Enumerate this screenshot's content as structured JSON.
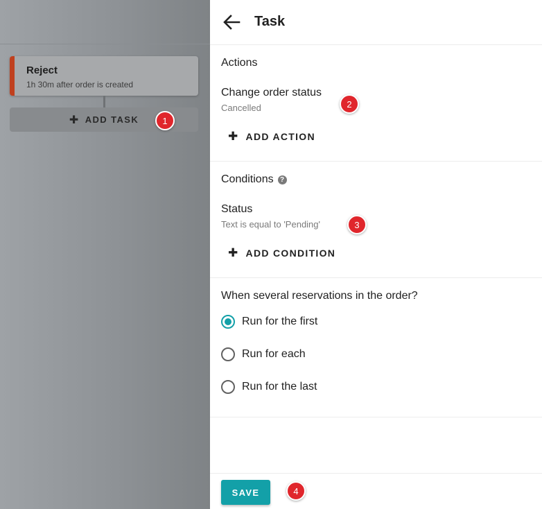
{
  "left": {
    "task_card": {
      "title": "Reject",
      "subtitle": "1h 30m after order is created"
    },
    "add_task_label": "ADD TASK"
  },
  "drawer": {
    "title": "Task",
    "actions": {
      "heading": "Actions",
      "item_title": "Change order status",
      "item_value": "Cancelled",
      "add_label": "ADD ACTION"
    },
    "conditions": {
      "heading": "Conditions",
      "item_title": "Status",
      "item_value": "Text is equal to 'Pending'",
      "add_label": "ADD CONDITION"
    },
    "reservations": {
      "question": "When several reservations in the order?",
      "options": [
        {
          "label": "Run for the first",
          "selected": true
        },
        {
          "label": "Run for each",
          "selected": false
        },
        {
          "label": "Run for the last",
          "selected": false
        }
      ]
    },
    "save_label": "SAVE"
  },
  "markers": [
    "1",
    "2",
    "3",
    "4"
  ],
  "colors": {
    "accent": "#13a0a8",
    "task_accent": "#c0401e",
    "marker": "#e0262c"
  }
}
